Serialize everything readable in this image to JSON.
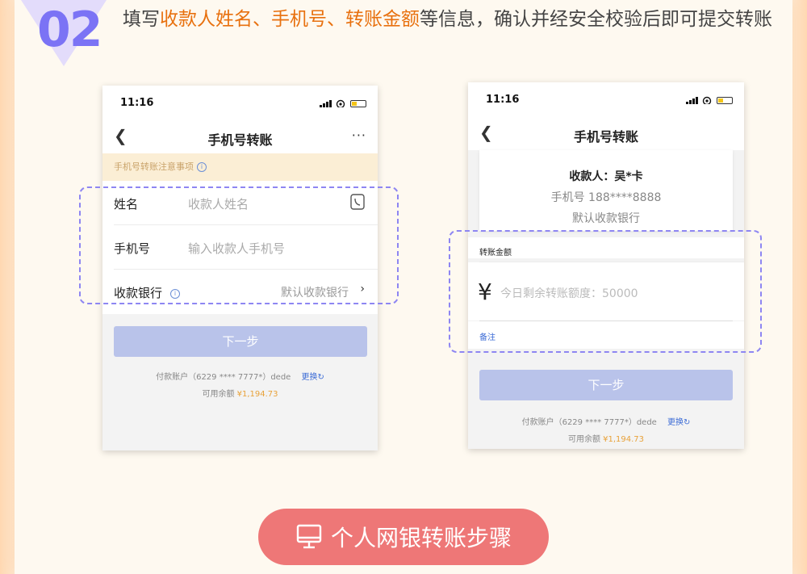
{
  "step": {
    "number": "02",
    "text_before": "填写",
    "highlight": "收款人姓名、手机号、转账金额",
    "text_after": "等信息，确认并经安全校验后即可提交转账"
  },
  "phone_left": {
    "time": "11:16",
    "nav_title": "手机号转账",
    "nav_more": "···",
    "notice": "手机号转账注意事项",
    "rows": [
      {
        "label": "姓名",
        "placeholder": "收款人姓名"
      },
      {
        "label": "手机号",
        "placeholder": "输入收款人手机号"
      },
      {
        "label": "收款银行",
        "value": "默认收款银行"
      }
    ],
    "button": "下一步",
    "pay_account": "付款账户（6229 **** 7777*）dede",
    "change": "更换",
    "balance_label": "可用余额",
    "balance_value": "¥1,194.73"
  },
  "phone_right": {
    "time": "11:16",
    "nav_title": "手机号转账",
    "payee_name": "收款人：吴*卡",
    "payee_phone": "手机号 188****8888",
    "payee_bank": "默认收款银行",
    "amount_label": "转账金额",
    "currency": "¥",
    "amount_placeholder": "今日剩余转账额度：50000",
    "remark": "备注",
    "button": "下一步",
    "pay_account": "付款账户（6229 **** 7777*）dede",
    "change": "更换",
    "balance_label": "可用余额",
    "balance_value": "¥1,194.73"
  },
  "footer_pill": {
    "label": "个人网银转账步骤",
    "icon": "monitor-icon"
  },
  "colors": {
    "accent_purple": "#7b73f5",
    "highlight_orange": "#e8710f",
    "pill_red": "#ee7777",
    "button_disabled": "#b9c3ea"
  }
}
